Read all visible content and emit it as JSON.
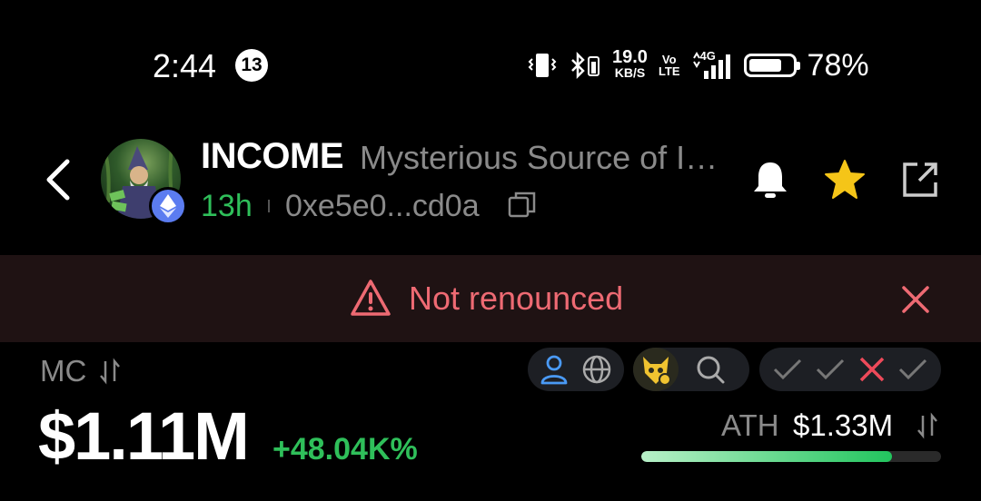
{
  "status_bar": {
    "time": "2:44",
    "notification_count": "13",
    "net_speed_value": "19.0",
    "net_speed_unit": "KB/S",
    "volte_top": "Vo",
    "volte_bottom": "LTE",
    "network": "4G",
    "battery_percent": "78%",
    "battery_level": 0.78
  },
  "header": {
    "token_symbol": "INCOME",
    "token_name": "Mysterious Source of I…",
    "age": "13h",
    "address": "0xe5e0...cd0a",
    "chain_icon": "ethereum-icon"
  },
  "banner": {
    "text": "Not renounced",
    "accent": "#ee6a73"
  },
  "stats": {
    "mc_label": "MC",
    "mc_value": "$1.11M",
    "mc_change": "+48.04K%",
    "ath_label": "ATH",
    "ath_value": "$1.33M",
    "ath_progress": 0.835
  },
  "checks": [
    {
      "icon": "check-icon",
      "status": "pass"
    },
    {
      "icon": "check-icon",
      "status": "pass"
    },
    {
      "icon": "cross-icon",
      "status": "fail"
    },
    {
      "icon": "check-icon",
      "status": "pass"
    }
  ],
  "colors": {
    "positive": "#2fbf5a",
    "warning": "#ee6a73",
    "star": "#f5c518"
  }
}
